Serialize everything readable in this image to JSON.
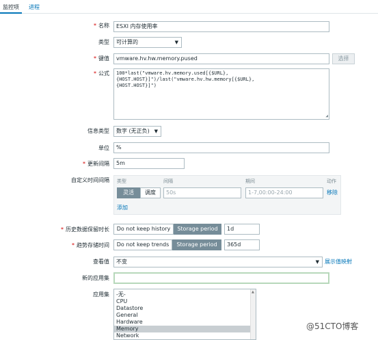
{
  "tabs": [
    {
      "label": "监控项",
      "active": true
    },
    {
      "label": "进程",
      "active": false
    }
  ],
  "form": {
    "name": {
      "label": "名称",
      "value": "ESXI 内存使用率",
      "required": true
    },
    "type": {
      "label": "类型",
      "value": "可计算的"
    },
    "key": {
      "label": "键值",
      "value": "vmware.hv.hw.memory.pused",
      "required": true,
      "button": "选择"
    },
    "formula": {
      "label": "公式",
      "required": true,
      "lines": [
        "100*last(\"vmware.hv.memory.used[{$URL},",
        "{HOST.HOST}]\")/last(\"vmware.hv.hw.memory[{$URL},",
        "{HOST.HOST}]\")"
      ]
    },
    "info_type": {
      "label": "信息类型",
      "value": "数字 (无正负)"
    },
    "units": {
      "label": "单位",
      "value": "%"
    },
    "update_interval": {
      "label": "更新间隔",
      "value": "5m",
      "required": true
    },
    "custom_intervals": {
      "label": "自定义时间间隔",
      "headers": {
        "type": "类型",
        "interval": "间隔",
        "period": "期间",
        "action": "动作"
      },
      "row": {
        "mode_flexible": "灵活",
        "mode_scheduling": "调度",
        "interval_placeholder": "50s",
        "period_placeholder": "1-7,00:00-24:00",
        "remove": "移除"
      },
      "add": "添加"
    },
    "history": {
      "label": "历史数据保留时长",
      "required": true,
      "option_off": "Do not keep history",
      "option_on": "Storage period",
      "value": "1d"
    },
    "trends": {
      "label": "趋势存储时间",
      "required": true,
      "option_off": "Do not keep trends",
      "option_on": "Storage period",
      "value": "365d"
    },
    "show_value": {
      "label": "查看值",
      "value": "不变",
      "link": "展示值映射"
    },
    "new_application": {
      "label": "新的应用集",
      "value": ""
    },
    "applications": {
      "label": "应用集",
      "options": [
        "-无-",
        "CPU",
        "Datastore",
        "General",
        "Hardware",
        "Memory",
        "Network"
      ],
      "selected": "Memory"
    }
  },
  "watermark": "@51CTO博客",
  "colors": {
    "accent": "#0275b8",
    "required": "#d40000",
    "segment_active": "#768d99",
    "focus_border": "#b7d8ba"
  }
}
